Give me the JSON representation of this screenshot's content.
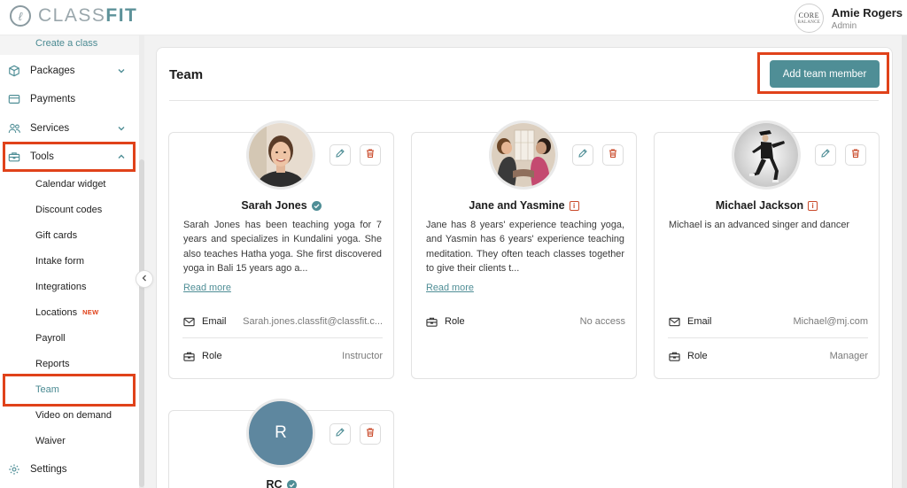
{
  "app": {
    "logo_text": "CLASSFIT",
    "logo_mark": "ℓ"
  },
  "user": {
    "name": "Amie Rogers",
    "role": "Admin",
    "brand_badge_line1": "CORE",
    "brand_badge_line2": "BALANCE"
  },
  "sidebar": {
    "create_class": "Create a class",
    "packages": "Packages",
    "payments": "Payments",
    "services": "Services",
    "tools": "Tools",
    "tools_items": [
      "Calendar widget",
      "Discount codes",
      "Gift cards",
      "Intake form",
      "Integrations",
      "Locations",
      "Payroll",
      "Reports",
      "Team",
      "Video on demand",
      "Waiver"
    ],
    "new_badge": "NEW",
    "settings": "Settings"
  },
  "main": {
    "title": "Team",
    "add_button": "Add team member",
    "labels": {
      "email": "Email",
      "role": "Role",
      "read_more": "Read more"
    },
    "members": [
      {
        "name": "Sarah Jones",
        "badge": "verified",
        "description": "Sarah Jones has been teaching yoga for 7 years and specializes in Kundalini yoga. She also teaches Hatha yoga. She first discovered yoga in Bali 15 years ago a...",
        "email": "Sarah.jones.classfit@classfit.c...",
        "role": "Instructor"
      },
      {
        "name": "Jane and Yasmine",
        "badge": "info",
        "description": "Jane has 8 years' experience teaching yoga, and Yasmin has 6 years' experience teaching meditation. They often teach classes together to give their clients t...",
        "role": "No access"
      },
      {
        "name": "Michael Jackson",
        "badge": "info",
        "description": "Michael is an advanced singer and dancer",
        "email": "Michael@mj.com",
        "role": "Manager"
      },
      {
        "name": "RC",
        "initial": "R",
        "badge": "verified"
      }
    ]
  },
  "colors": {
    "accent": "#4f8e96",
    "highlight": "#e0421a",
    "avatar_initial_bg": "#5e879f"
  },
  "icons": [
    "chevron-down-icon",
    "chevron-up-icon",
    "package-icon",
    "card-icon",
    "people-icon",
    "toolbox-icon",
    "gear-icon",
    "pencil-icon",
    "trash-icon",
    "mail-icon",
    "briefcase-icon",
    "chevron-left-icon",
    "verified-icon",
    "info-icon"
  ]
}
